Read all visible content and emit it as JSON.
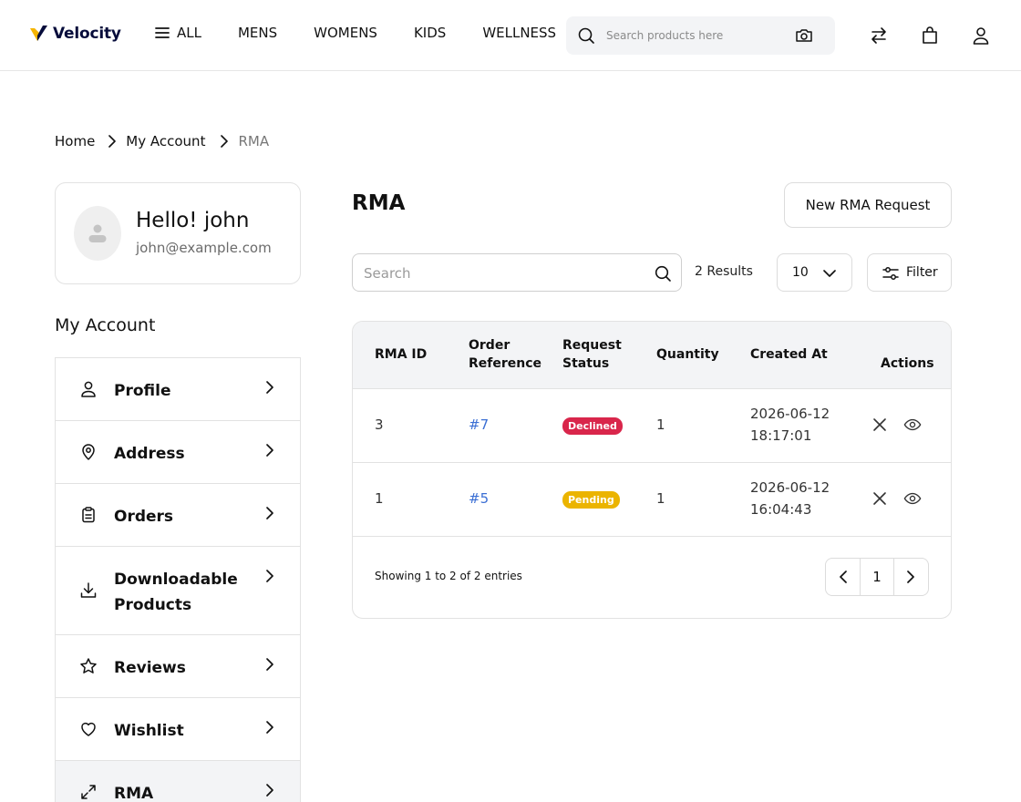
{
  "header": {
    "brand": "Velocity",
    "nav": [
      {
        "label": "ALL"
      },
      {
        "label": "MENS"
      },
      {
        "label": "WOMENS"
      },
      {
        "label": "KIDS"
      },
      {
        "label": "WELLNESS"
      }
    ],
    "search_placeholder": "Search products here"
  },
  "breadcrumb": {
    "home": "Home",
    "account": "My Account",
    "current": "RMA"
  },
  "profile": {
    "greeting": "Hello! john",
    "email": "john@example.com"
  },
  "sidebar": {
    "title": "My Account",
    "items": [
      {
        "label": "Profile",
        "icon": "user-icon"
      },
      {
        "label": "Address",
        "icon": "location-pin-icon"
      },
      {
        "label": "Orders",
        "icon": "clipboard-icon"
      },
      {
        "label": "Downloadable Products",
        "icon": "download-icon"
      },
      {
        "label": "Reviews",
        "icon": "star-icon"
      },
      {
        "label": "Wishlist",
        "icon": "heart-icon"
      },
      {
        "label": "RMA",
        "icon": "swap-icon"
      }
    ],
    "active": "RMA"
  },
  "main": {
    "title": "RMA",
    "new_button": "New RMA Request",
    "search_placeholder": "Search",
    "results": "2 Results",
    "per_page": "10",
    "filter_label": "Filter",
    "table": {
      "headers": [
        "RMA ID",
        "Order Reference",
        "Request Status",
        "Quantity",
        "Created At",
        "Actions"
      ],
      "rows": [
        {
          "rma_id": "3",
          "order_ref": "#7",
          "status": "Declined",
          "quantity": "1",
          "created_at": "2026-06-12 18:17:01"
        },
        {
          "rma_id": "1",
          "order_ref": "#5",
          "status": "Pending",
          "quantity": "1",
          "created_at": "2026-06-12 16:04:43"
        }
      ]
    },
    "showing": "Showing 1 to 2 of 2 entries",
    "current_page": "1"
  },
  "colors": {
    "brand_navy": "#060c3b",
    "brand_yellow": "#f5b400",
    "link_blue": "#3b6fd4",
    "declined_red": "#d9264b",
    "pending_yellow": "#ebb400"
  }
}
